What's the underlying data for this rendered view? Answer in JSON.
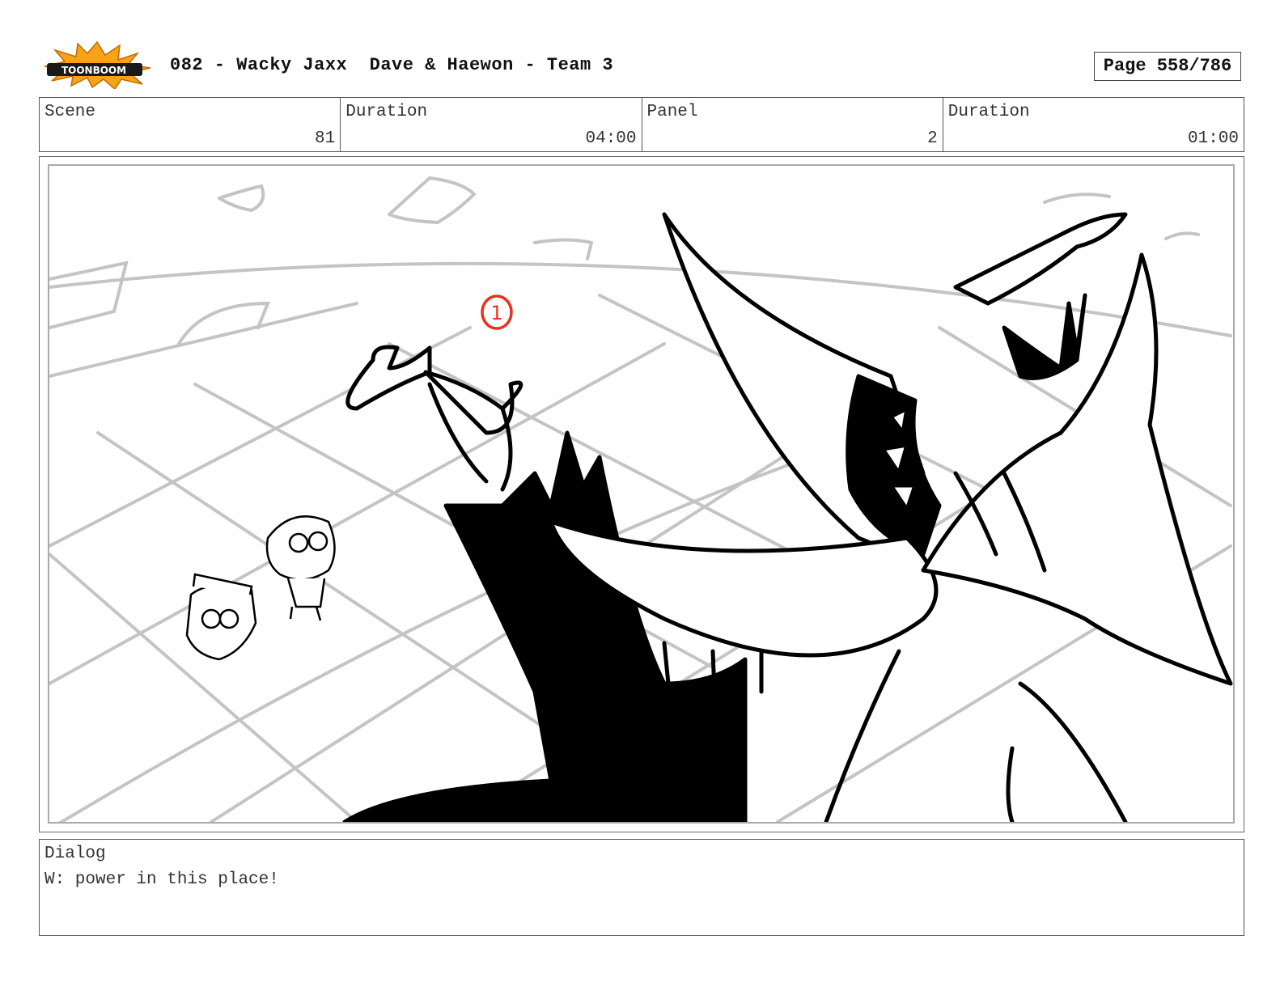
{
  "header": {
    "logo_text": "TOONBOOM",
    "title": "082 - Wacky Jaxx  Dave & Haewon - Team 3",
    "page": "Page 558/786"
  },
  "info": {
    "scene_label": "Scene",
    "scene_value": "81",
    "scene_duration_label": "Duration",
    "scene_duration_value": "04:00",
    "panel_label": "Panel",
    "panel_value": "2",
    "panel_duration_label": "Duration",
    "panel_duration_value": "01:00"
  },
  "panel": {
    "annotation": "1"
  },
  "dialog": {
    "label": "Dialog",
    "text": "W: power in this place!"
  },
  "colors": {
    "logo_burst": "#f5a41a",
    "annotation": "#e8321e",
    "sketch_grey": "#c4c4c4",
    "ink": "#000000"
  }
}
